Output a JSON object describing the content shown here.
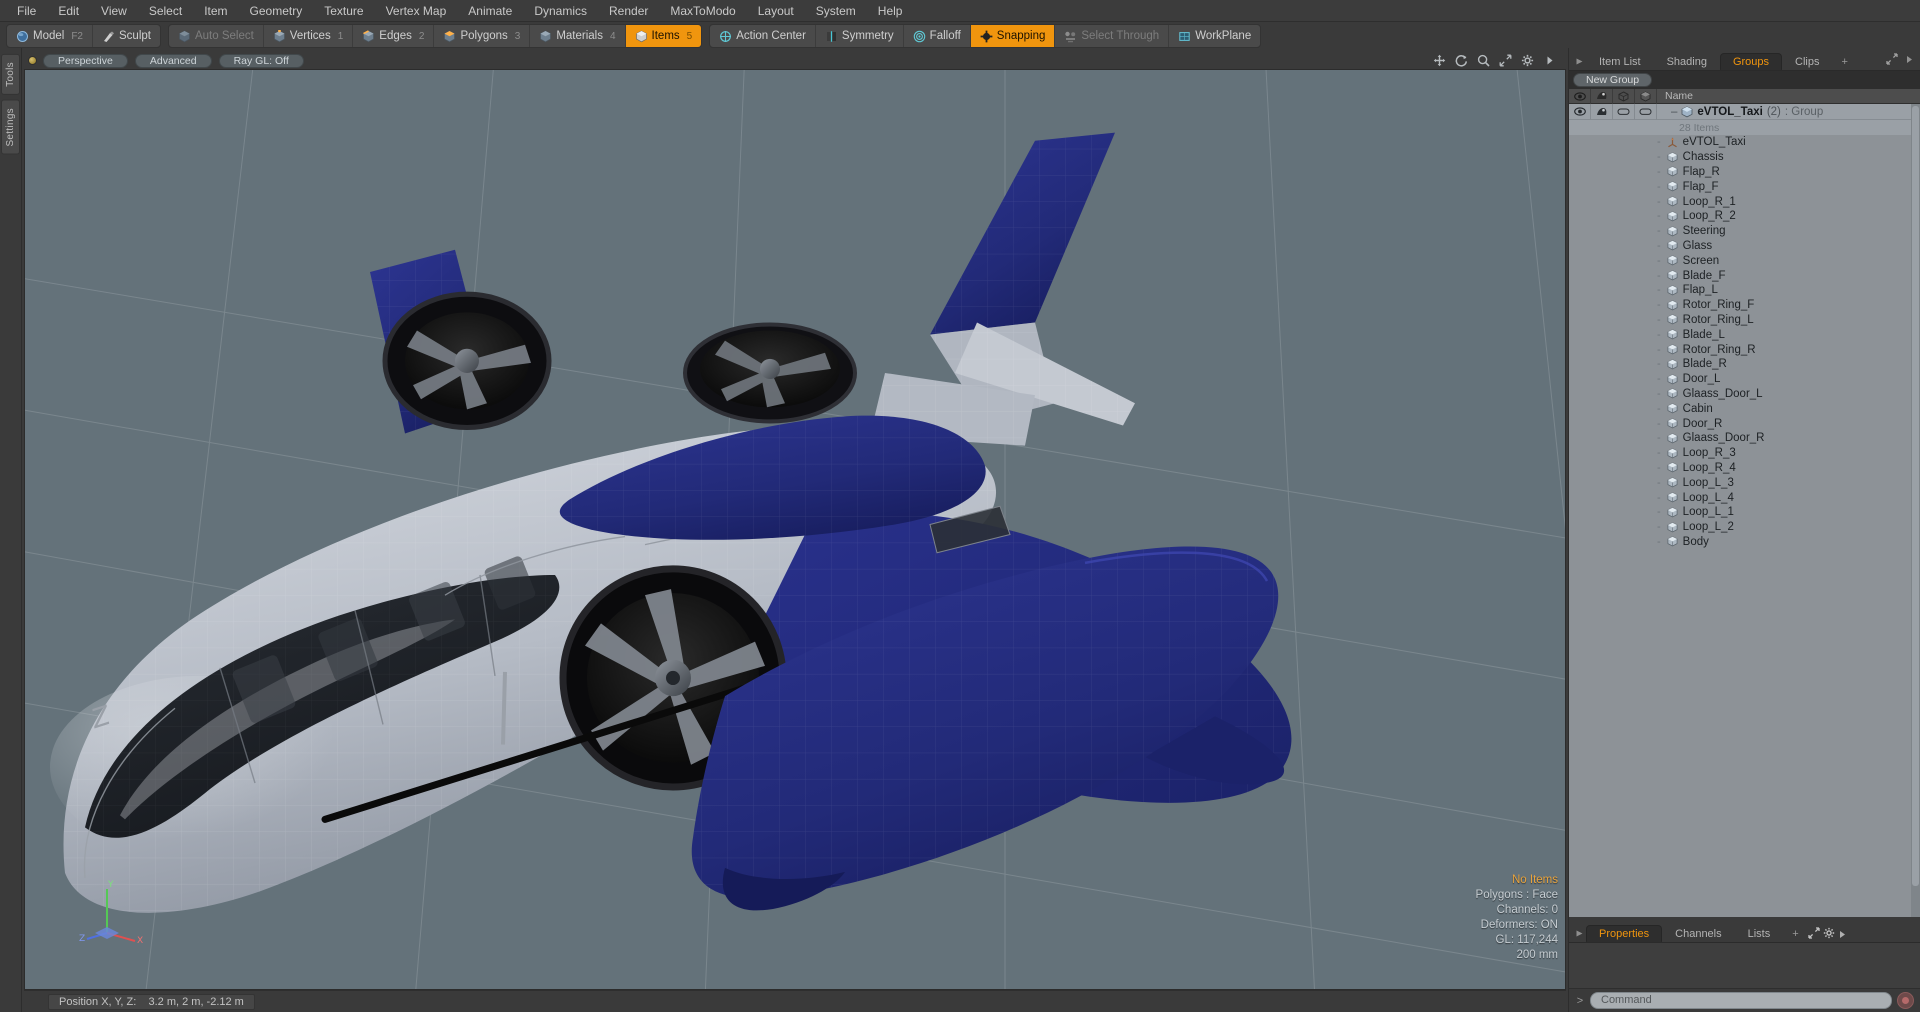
{
  "app": {
    "title": "Modo"
  },
  "menubar": {
    "items": [
      {
        "label": "File"
      },
      {
        "label": "Edit"
      },
      {
        "label": "View"
      },
      {
        "label": "Select"
      },
      {
        "label": "Item"
      },
      {
        "label": "Geometry"
      },
      {
        "label": "Texture"
      },
      {
        "label": "Vertex Map"
      },
      {
        "label": "Animate"
      },
      {
        "label": "Dynamics"
      },
      {
        "label": "Render"
      },
      {
        "label": "MaxToModo"
      },
      {
        "label": "Layout"
      },
      {
        "label": "System"
      },
      {
        "label": "Help"
      }
    ]
  },
  "toolbar": {
    "groups": [
      {
        "buttons": [
          {
            "label": "Model",
            "icon": "sphere-icon",
            "state": "normal",
            "shortcut": "F2"
          },
          {
            "label": "Sculpt",
            "icon": "brush-icon",
            "state": "normal",
            "shortcut": ""
          }
        ]
      },
      {
        "buttons": [
          {
            "label": "Auto Select",
            "icon": "cube-icon",
            "state": "dim",
            "shortcut": ""
          },
          {
            "label": "Vertices",
            "icon": "cube-icon",
            "state": "normal",
            "shortcut": "1"
          },
          {
            "label": "Edges",
            "icon": "cube-icon",
            "state": "normal",
            "shortcut": "2"
          },
          {
            "label": "Polygons",
            "icon": "cube-icon",
            "state": "normal",
            "shortcut": "3"
          },
          {
            "label": "Materials",
            "icon": "cube-icon",
            "state": "normal",
            "shortcut": "4"
          },
          {
            "label": "Items",
            "icon": "cube-icon",
            "state": "active",
            "shortcut": "5"
          }
        ]
      },
      {
        "buttons": [
          {
            "label": "Action Center",
            "icon": "target-icon",
            "state": "normal",
            "shortcut": ""
          },
          {
            "label": "Symmetry",
            "icon": "symmetry-icon",
            "state": "normal",
            "shortcut": ""
          },
          {
            "label": "Falloff",
            "icon": "falloff-icon",
            "state": "normal",
            "shortcut": ""
          },
          {
            "label": "Snapping",
            "icon": "snap-icon",
            "state": "active",
            "shortcut": ""
          },
          {
            "label": "Select Through",
            "icon": "selectthrough-icon",
            "state": "dim",
            "shortcut": ""
          },
          {
            "label": "WorkPlane",
            "icon": "workplane-icon",
            "state": "normal",
            "shortcut": ""
          }
        ]
      }
    ]
  },
  "left_strip": {
    "tabs": [
      "Tools",
      "Settings"
    ]
  },
  "viewport": {
    "header": {
      "view_mode": "Perspective",
      "shading_mode": "Advanced",
      "ray_gl": "Ray GL: Off",
      "icons": [
        "move-icon",
        "rotate-icon",
        "zoom-icon",
        "fit-icon",
        "gear-icon",
        "chevron-right-icon"
      ]
    },
    "stats": {
      "selection": "No Items",
      "polygons": "Polygons : Face",
      "channels": "Channels: 0",
      "deformers": "Deformers: ON",
      "gl": "GL: 117,244",
      "grid": "200 mm"
    },
    "axis_labels": {
      "x": "X",
      "y": "Y",
      "z": "Z"
    },
    "model": {
      "name": "eVTOL_Taxi",
      "body_color": "#b9bec7",
      "accent_color": "#232a7a",
      "glass_color": "#20232a",
      "background_color": "#64727a"
    }
  },
  "right_panel": {
    "tabs": [
      {
        "label": "Item List",
        "active": false
      },
      {
        "label": "Shading",
        "active": false
      },
      {
        "label": "Groups",
        "active": true
      },
      {
        "label": "Clips",
        "active": false
      },
      {
        "label": "+",
        "active": false
      }
    ],
    "new_group_button": "New Group",
    "list_header": {
      "columns": [
        "eye-icon",
        "render-icon",
        "wireframe-icon",
        "shaded-icon"
      ],
      "name": "Name"
    },
    "group": {
      "name": "eVTOL_Taxi",
      "count": "(2)",
      "type": ": Group",
      "item_count": "28 Items"
    },
    "items": [
      {
        "label": "eVTOL_Taxi",
        "icon": "locator-icon"
      },
      {
        "label": "Chassis",
        "icon": "mesh-icon"
      },
      {
        "label": "Flap_R",
        "icon": "mesh-icon"
      },
      {
        "label": "Flap_F",
        "icon": "mesh-icon"
      },
      {
        "label": "Loop_R_1",
        "icon": "mesh-icon"
      },
      {
        "label": "Loop_R_2",
        "icon": "mesh-icon"
      },
      {
        "label": "Steering",
        "icon": "mesh-icon"
      },
      {
        "label": "Glass",
        "icon": "mesh-icon"
      },
      {
        "label": "Screen",
        "icon": "mesh-icon"
      },
      {
        "label": "Blade_F",
        "icon": "mesh-icon"
      },
      {
        "label": "Flap_L",
        "icon": "mesh-icon"
      },
      {
        "label": "Rotor_Ring_F",
        "icon": "mesh-icon"
      },
      {
        "label": "Rotor_Ring_L",
        "icon": "mesh-icon"
      },
      {
        "label": "Blade_L",
        "icon": "mesh-icon"
      },
      {
        "label": "Rotor_Ring_R",
        "icon": "mesh-icon"
      },
      {
        "label": "Blade_R",
        "icon": "mesh-icon"
      },
      {
        "label": "Door_L",
        "icon": "mesh-icon"
      },
      {
        "label": "Glaass_Door_L",
        "icon": "mesh-icon"
      },
      {
        "label": "Cabin",
        "icon": "mesh-icon"
      },
      {
        "label": "Door_R",
        "icon": "mesh-icon"
      },
      {
        "label": "Glaass_Door_R",
        "icon": "mesh-icon"
      },
      {
        "label": "Loop_R_3",
        "icon": "mesh-icon"
      },
      {
        "label": "Loop_R_4",
        "icon": "mesh-icon"
      },
      {
        "label": "Loop_L_3",
        "icon": "mesh-icon"
      },
      {
        "label": "Loop_L_4",
        "icon": "mesh-icon"
      },
      {
        "label": "Loop_L_1",
        "icon": "mesh-icon"
      },
      {
        "label": "Loop_L_2",
        "icon": "mesh-icon"
      },
      {
        "label": "Body",
        "icon": "mesh-icon"
      }
    ],
    "bottom_tabs": [
      {
        "label": "Properties",
        "active": true
      },
      {
        "label": "Channels",
        "active": false
      },
      {
        "label": "Lists",
        "active": false
      },
      {
        "label": "+",
        "active": false
      }
    ]
  },
  "command_bar": {
    "placeholder": "Command",
    "prompt": ">"
  },
  "status_bar": {
    "position_label": "Position X, Y, Z:",
    "position_value": "3.2 m, 2 m, -2.12 m"
  },
  "colors": {
    "accent": "#f0950e",
    "panel": "#3a3a3a",
    "viewport_bg": "#64727a",
    "list_bg": "#9aa0a6"
  }
}
